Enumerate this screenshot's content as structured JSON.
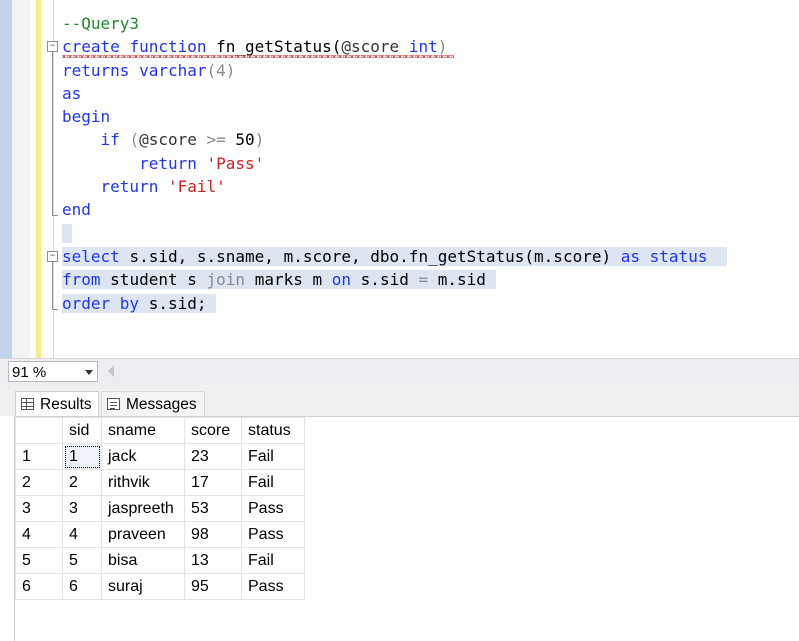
{
  "editor": {
    "comment": "--Query3",
    "lines": {
      "l2": {
        "a": "create",
        "b": "function",
        "c": "fn_getStatus(",
        "d": "@score",
        "e": "int",
        ")": ")"
      },
      "l3": {
        "a": "returns",
        "b": "varchar",
        "c": "(4)"
      },
      "l4": {
        "a": "as"
      },
      "l5": {
        "a": "begin"
      },
      "l6": {
        "a": "if",
        "b": "(",
        "c": "@score",
        ">": ">=",
        "n": "50",
        ")": ")"
      },
      "l7": {
        "a": "return",
        "b": "'Pass'"
      },
      "l8": {
        "a": "return",
        "b": "'Fail'"
      },
      "l9": {
        "a": "end"
      },
      "l11": {
        "a": "select",
        "b": "s.sid,",
        "c": "s.sname,",
        "d": "m.score,",
        "e": "dbo.fn_getStatus(m.score)",
        "f": "as",
        "g": "status"
      },
      "l12": {
        "a": "from",
        "b": "student s",
        "c": "join",
        "d": "marks m",
        "e": "on",
        "f": "s.sid",
        "g": "=",
        "h": "m.sid"
      },
      "l13": {
        "a": "order by",
        "b": "s.sid;"
      }
    }
  },
  "zoom": {
    "value": "91 %"
  },
  "tabs": {
    "results": "Results",
    "messages": "Messages"
  },
  "grid": {
    "headers": [
      "sid",
      "sname",
      "score",
      "status"
    ],
    "rows": [
      {
        "n": "1",
        "sid": "1",
        "sname": "jack",
        "score": "23",
        "status": "Fail"
      },
      {
        "n": "2",
        "sid": "2",
        "sname": "rithvik",
        "score": "17",
        "status": "Fail"
      },
      {
        "n": "3",
        "sid": "3",
        "sname": "jaspreeth",
        "score": "53",
        "status": "Pass"
      },
      {
        "n": "4",
        "sid": "4",
        "sname": "praveen",
        "score": "98",
        "status": "Pass"
      },
      {
        "n": "5",
        "sid": "5",
        "sname": "bisa",
        "score": "13",
        "status": "Fail"
      },
      {
        "n": "6",
        "sid": "6",
        "sname": "suraj",
        "score": "95",
        "status": "Pass"
      }
    ]
  }
}
